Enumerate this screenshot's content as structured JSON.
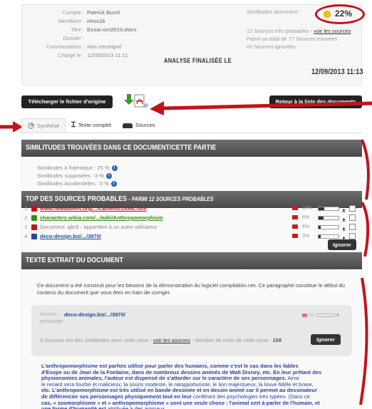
{
  "meta": [
    {
      "key": "Compte :",
      "value": "Patrick Burel",
      "style": "bold"
    },
    {
      "key": "Identifiant :",
      "value": "imsx16",
      "style": "bold"
    },
    {
      "key": "Titre :",
      "value": "Essai-oct2013.docx",
      "style": "bold"
    },
    {
      "key": "Dossier :",
      "value": "",
      "style": "bold"
    },
    {
      "key": "Commentaires :",
      "value": "Non renseigné",
      "style": "italic"
    },
    {
      "key": "Chargé le :",
      "value": "12/09/2013 11:11",
      "style": "plain"
    }
  ],
  "analyse_label": "ANALYSE FINALISÉE LE",
  "analyse_date": "12/09/2013 11:13",
  "similitudes": {
    "title": "Similitudes document :",
    "percent": "22%",
    "line1_prefix": "12 Sources très probables - ",
    "line1_link": "voir les sources",
    "line2": "Parmi un total de 77 Sources trouvées",
    "line3": "62 Sources ignorées"
  },
  "buttons": {
    "download": "Télécharger le fichier d'origine",
    "back": "Retour à la liste des documents",
    "ignorer": "Ignorer"
  },
  "tabs": [
    {
      "label": "Synthèse",
      "icon": "pie-chart-icon"
    },
    {
      "label": "Texte complet",
      "icon": "text-icon"
    },
    {
      "label": "Sources",
      "icon": "car-icon"
    }
  ],
  "section1": {
    "title": "SIMILITUDES TROUVÉES DANS CE DOCUMENT/CETTE PARTIE",
    "stats": [
      "Similitudes à l'identique : 25 %",
      "Similitudes supposées : 3 %",
      "Similitudes accidentelles : 0 %"
    ]
  },
  "section2": {
    "title": "TOP DES SOURCES PROBABLES",
    "subtitle": "- PARMI 12 SOURCES PROBABLES",
    "sources": [
      {
        "num": "1.",
        "name": "www.newadvent.org/.../cathen/01558c.htm",
        "color": "red",
        "pct": "10%",
        "fill": 0.3
      },
      {
        "num": "2.",
        "name": "characters.wikia.com/.../wiki/Anthropomorphism",
        "color": "green",
        "pct": "8%",
        "fill": 0.25
      },
      {
        "num": "3.",
        "name": "Document: ajkr8 - appartient à un autre utilisateur",
        "color": "grey",
        "pct": "4%",
        "fill": 0.12
      },
      {
        "num": "4.",
        "name": "deco-design.biz/.../3970/",
        "color": "blue",
        "pct": "3%",
        "fill": 0.1
      }
    ]
  },
  "section3": {
    "title": "TEXTE EXTRAIT DU DOCUMENT",
    "intro": "Ce document a été construit pour les besoins de la démonstration du logiciel compilation.net. Ce paragraphe constitue le début du contenu du document que vous êtes en train de corriger.",
    "card": {
      "label_line1": "Source",
      "label_line2": "principale",
      "link": "deco-design.biz/.../3970/",
      "mini_pct": "3%",
      "info_prefix": "4 Sources ont des similitudes avec cette zone - ",
      "info_link": "voir les sources",
      "info_suffix": " - Nombre de mots de cette zone : ",
      "info_count": "109"
    },
    "text": [
      {
        "t": "L'anthropomorphisme est parfois utilisé pour parler des humains, comme c'est le cas dans les fables",
        "b": true
      },
      {
        "t": "d'Ésope ou de Jean de la Fontaine, dans de nombreux dessins animés de Walt Disney, etc. En leur prêtant des",
        "b": true
      },
      {
        "t": "physionomies animales, l'auteur est dispensé de s'attarder sur le caractère de ses personnages.",
        "b": true,
        "tail": " Ainsi"
      },
      {
        "t": "le renard sera fourbe et malicieux, la souris modeste, le ratopportuniste, le lion majestueux, la louve fidèle et brave,",
        "b": false
      },
      {
        "t": "etc. L'anthropomorphisme est très utilisé en bande dessinée et en dessin animé car il permet au dessinateur",
        "b": true
      },
      {
        "t": "de différencier ses personnages physiquement tout en leur",
        "b": true,
        "tail": " conférant des psychologies très typées. (Dans ce"
      },
      {
        "t": "cas, « zoomorphisme » et « anthropomorphisme » sont une seule chose : l'animal sert à parler de l'humain, et",
        "b": true
      },
      {
        "t": "une forme d'humanité est",
        "b": true,
        "tail": " attribuée à des animaux."
      }
    ]
  },
  "colors": {
    "annotation_red": "#c41219",
    "header_dark": "#4a4a4a",
    "link_blue": "#1f4b99"
  }
}
